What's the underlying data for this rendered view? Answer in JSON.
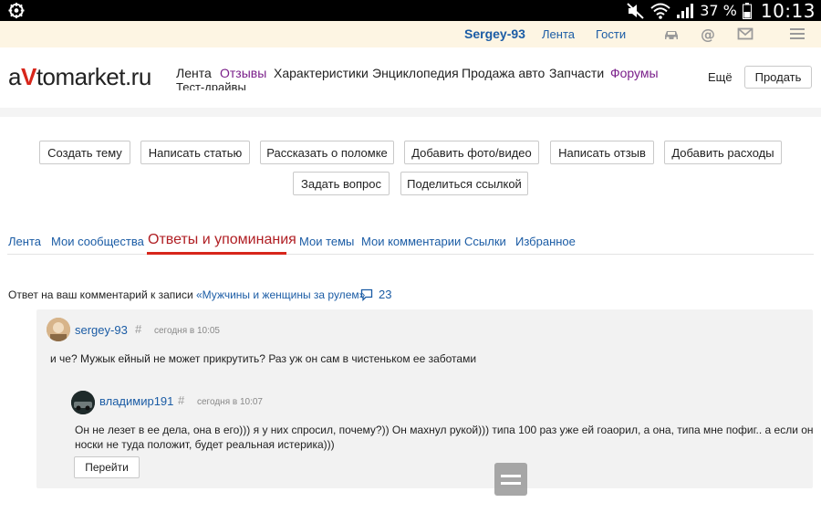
{
  "status_bar": {
    "battery": "37 %",
    "time": "10:13"
  },
  "user_bar": {
    "username": "Sergey-93",
    "feed": "Лента",
    "guests": "Гости",
    "icons": [
      "car-icon",
      "at-icon",
      "mail-icon",
      "hamburger-icon"
    ]
  },
  "header": {
    "logo_a": "a",
    "logo_v": "V",
    "logo_rest": "tomarket.ru",
    "nav": [
      {
        "label": "Лента",
        "color": "#222222"
      },
      {
        "label": "Отзывы",
        "color": "#7a1f8a"
      },
      {
        "label": "Характеристики",
        "color": "#222222"
      },
      {
        "label": "Энциклопедия",
        "color": "#222222"
      },
      {
        "label": "Продажа авто",
        "color": "#222222"
      },
      {
        "label": "Запчасти",
        "color": "#222222"
      },
      {
        "label": "Форумы",
        "color": "#7a1f8a"
      }
    ],
    "nav_sub": "Тест-драйвы",
    "more": "Ещё",
    "sell": "Продать"
  },
  "actions": [
    "Создать тему",
    "Написать статью",
    "Рассказать о поломке",
    "Добавить фото/видео",
    "Написать отзыв",
    "Добавить расходы",
    "Задать вопрос",
    "Поделиться ссылкой"
  ],
  "tabs": [
    "Лента",
    "Мои сообщества",
    "Ответы и упоминания",
    "Мои темы",
    "Мои комментарии",
    "Ссылки",
    "Избранное"
  ],
  "active_tab": "Ответы и упоминания",
  "entry": {
    "header_text": "Ответ на ваш комментарий к записи ",
    "post_title": "«Мужчины и женщины за рулем»",
    "comment_count": "23",
    "comment": {
      "author": "sergey-93",
      "hash": "#",
      "time": "сегодня в 10:05",
      "text": "и че? Мужык ейный не может прикрутить? Раз уж он сам в чистеньком ее заботами"
    },
    "reply": {
      "author": "владимир191",
      "hash": "#",
      "time": "сегодня в 10:07",
      "text_line1": "Он не лезет в ее дела, она в его))) я у них спросил, почему?)) Он махнул рукой))) типа 100 раз уже ей гоаорил, а она, типа мне пофиг.. а если он",
      "text_line2": "носки не туда положит, будет реальная истерика)))"
    },
    "goto_button": "Перейти"
  },
  "colors": {
    "link": "#1b5ca5",
    "accent_red": "#d7261b",
    "user_bar_bg": "#fdf5e3",
    "card_bg": "#f2f2f2"
  }
}
